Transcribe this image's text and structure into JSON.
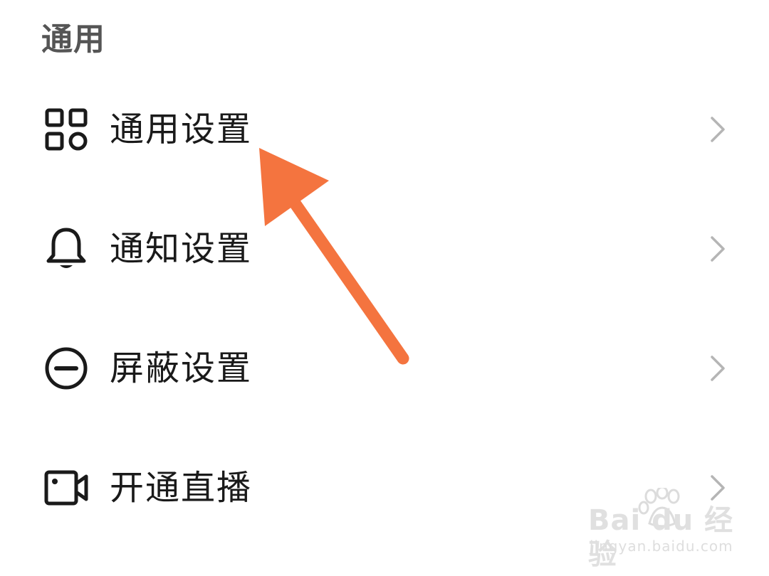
{
  "section": {
    "title": "通用"
  },
  "items": [
    {
      "label": "通用设置",
      "icon": "grid-apps-icon"
    },
    {
      "label": "通知设置",
      "icon": "bell-icon"
    },
    {
      "label": "屏蔽设置",
      "icon": "block-minus-icon"
    },
    {
      "label": "开通直播",
      "icon": "video-camera-icon"
    }
  ],
  "annotation": {
    "color": "#F4743F"
  },
  "watermark": {
    "brand": "Bai du 经验",
    "url": "jingyan.baidu.com"
  }
}
